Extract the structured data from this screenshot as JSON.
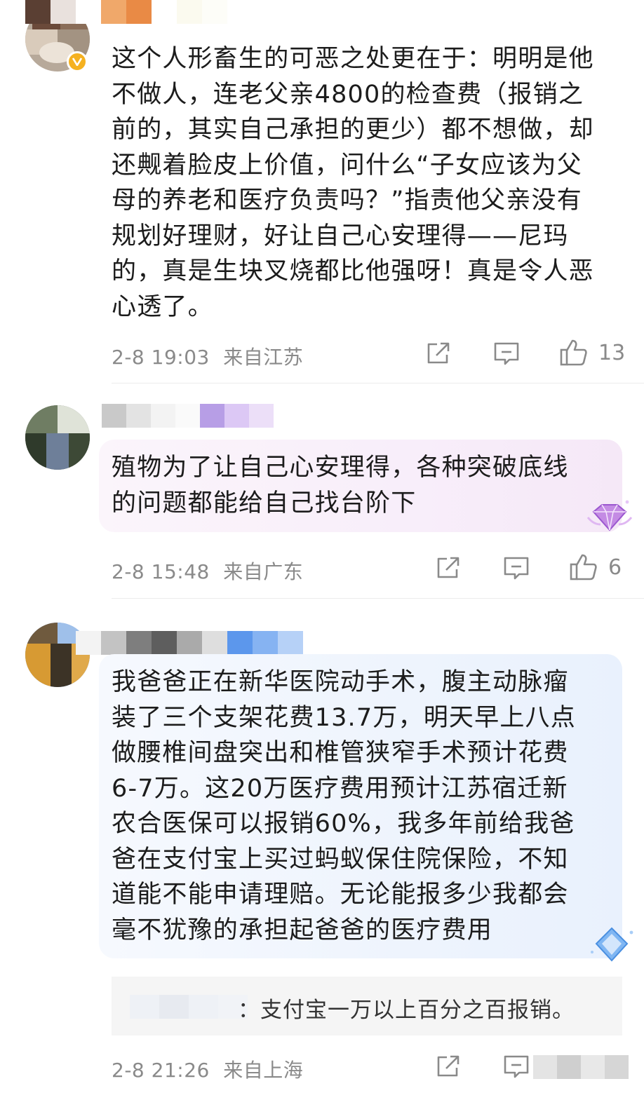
{
  "comments": [
    {
      "text": "这个人形畜生的可恶之处更在于：明明是他\n不做人，连老父亲4800的检查费（报销之\n前的，其实自己承担的更少）都不想做，却\n还觍着脸皮上价值，问什么“子女应该为父\n母的养老和医疗负责吗？”指责他父亲没有\n规划好理财，好让自己心安理得——尼玛\n的，真是生块叉烧都比他强呀！真是令人恶\n心透了。",
      "time": "2-8 19:03",
      "location": "来自江苏",
      "likes": "13"
    },
    {
      "text": "殖物为了让自己心安理得，各种突破底线\n的问题都能给自己找台阶下",
      "time": "2-8 15:48",
      "location": "来自广东",
      "likes": "6"
    },
    {
      "text": "我爸爸正在新华医院动手术，腹主动脉瘤\n装了三个支架花费13.7万，明天早上八点\n做腰椎间盘突出和椎管狭窄手术预计花费\n6-7万。这20万医疗费用预计江苏宿迁新\n农合医保可以报销60%，我多年前给我爸\n爸在支付宝上买过蚂蚁保住院保险，不知\n道能不能申请理赔。无论能报多少我都会\n毫不犹豫的承担起爸爸的医疗费用",
      "time": "2-8 21:26",
      "location": "来自上海",
      "reply": "：支付宝一万以上百分之百报销。"
    }
  ],
  "icons": {
    "share": "share-icon",
    "comment": "comment-icon",
    "like": "thumbs-up-icon",
    "verified": "verified-badge-icon",
    "vip_pink": "gem-badge-icon",
    "vip_blue": "diamond-badge-icon"
  },
  "colors": {
    "text": "#1c1c1c",
    "meta": "#8a8a8a",
    "verified": "#f5b120",
    "pink_badge": "#b26ad8",
    "blue_badge": "#5ea5f0"
  }
}
